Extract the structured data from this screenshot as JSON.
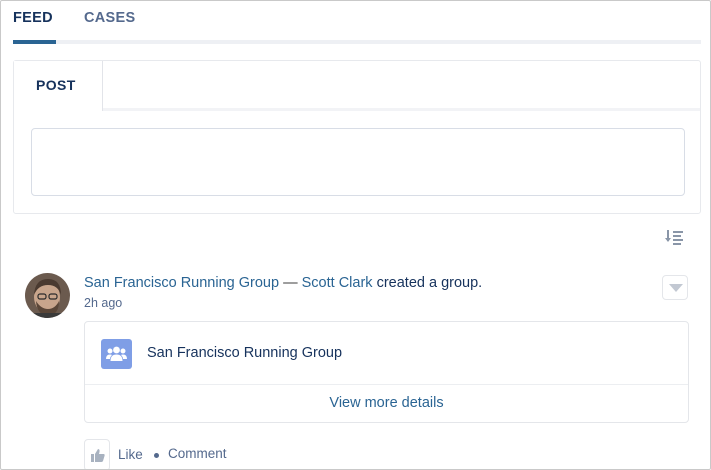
{
  "tabs": [
    {
      "label": "FEED",
      "active": true
    },
    {
      "label": "CASES",
      "active": false
    }
  ],
  "publisher": {
    "tab_label": "POST",
    "input_value": ""
  },
  "feed_item": {
    "group_link": "San Francisco Running Group",
    "separator": "—",
    "author_link": "Scott Clark",
    "action_text": "created a group.",
    "timestamp": "2h ago",
    "card": {
      "group_name": "San Francisco Running Group",
      "view_more": "View more details"
    },
    "actions": {
      "like": "Like",
      "comment": "Comment"
    }
  },
  "icons": {
    "sort": "sort-icon",
    "menu": "chevron-down-icon",
    "group": "group-icon",
    "like": "thumbs-up-icon"
  },
  "colors": {
    "link": "#2a6493",
    "active_tab_underline": "#2a6493",
    "group_icon_bg": "#7f9ee6"
  }
}
